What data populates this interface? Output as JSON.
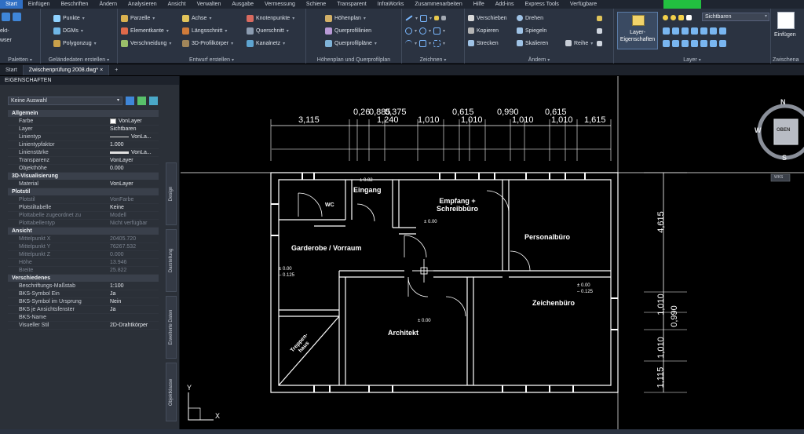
{
  "menu": {
    "tabs": [
      "Start",
      "Einfügen",
      "Beschriften",
      "Ändern",
      "Analysieren",
      "Ansicht",
      "Verwalten",
      "Ausgabe",
      "Vermessung",
      "Schiene",
      "Transparent",
      "InfraWorks",
      "Zusammenarbeiten",
      "Hilfe",
      "Add-ins",
      "Express Tools",
      "Verfügbare"
    ],
    "active": "Start"
  },
  "ribbon": {
    "left_stub": {
      "label_1": "ekt-",
      "label_2": "wser",
      "title": "Paletten"
    },
    "gelaende": {
      "title": "Geländedaten erstellen",
      "items": [
        "Punkte",
        "DGMs",
        "Polygonzug"
      ]
    },
    "entwurf": {
      "title": "Entwurf erstellen",
      "col1": [
        "Parzelle",
        "Elementkante",
        "Verschneidung"
      ],
      "col2": [
        "Achse",
        "Längsschnitt",
        "3D-Profilkörper"
      ],
      "col3": [
        "Knotenpunkte",
        "Querschnitt",
        "Kanalnetz"
      ]
    },
    "hoehenplan": {
      "title": "Höhenplan und Querprofilplan",
      "items": [
        "Höhenplan",
        "Querprofillinien",
        "Querprofilpläne"
      ]
    },
    "zeichnen": {
      "title": "Zeichnen"
    },
    "aendern": {
      "title": "Ändern",
      "col1": [
        "Verschieben",
        "Kopieren",
        "Strecken"
      ],
      "col2": [
        "Drehen",
        "Spiegeln",
        "Skalieren"
      ],
      "reihe": "Reihe"
    },
    "layer": {
      "button_line1": "Layer-",
      "button_line2": "Eigenschaften",
      "current": "Sichtbaren",
      "title": "Layer"
    },
    "einfuegen": {
      "label": "Einfügen",
      "title": "Zwischena"
    }
  },
  "document_tabs": [
    "Start",
    "Zwischenprüfung 2008.dwg*"
  ],
  "palette": {
    "title": "EIGENSCHAFTEN",
    "selection": "Keine Auswahl",
    "side_tabs": [
      "Design",
      "Darstellung",
      "Erweiterte Daten",
      "Objektklasse"
    ],
    "sections": [
      {
        "name": "Allgemein",
        "rows": [
          {
            "key": "Farbe",
            "value": "VonLayer"
          },
          {
            "key": "Layer",
            "value": "Sichtbaren"
          },
          {
            "key": "Linientyp",
            "value": "VonLa..."
          },
          {
            "key": "Linientypfaktor",
            "value": "1.000"
          },
          {
            "key": "Linienstärke",
            "value": "VonLa..."
          },
          {
            "key": "Transparenz",
            "value": "VonLayer"
          },
          {
            "key": "Objekthöhe",
            "value": "0.000"
          }
        ]
      },
      {
        "name": "3D-Visualisierung",
        "rows": [
          {
            "key": "Material",
            "value": "VonLayer"
          }
        ]
      },
      {
        "name": "Plotstil",
        "rows": [
          {
            "key": "Plotstil",
            "value": "VonFarbe"
          },
          {
            "key": "Plotstiltabelle",
            "value": "Keine"
          },
          {
            "key": "Plottabelle zugeordnet zu",
            "value": "Modell"
          },
          {
            "key": "Plottabellentyp",
            "value": "Nicht verfügbar"
          }
        ]
      },
      {
        "name": "Ansicht",
        "rows": [
          {
            "key": "Mittelpunkt X",
            "value": "20405.720"
          },
          {
            "key": "Mittelpunkt Y",
            "value": "76267.532"
          },
          {
            "key": "Mittelpunkt Z",
            "value": "0.000"
          },
          {
            "key": "Höhe",
            "value": "13.946"
          },
          {
            "key": "Breite",
            "value": "25.822"
          }
        ]
      },
      {
        "name": "Verschiedenes",
        "rows": [
          {
            "key": "Beschriftungs-Maßstab",
            "value": "1:100"
          },
          {
            "key": "BKS-Symbol Ein",
            "value": "Ja"
          },
          {
            "key": "BKS-Symbol im Ursprung",
            "value": "Nein"
          },
          {
            "key": "BKS je Ansichtsfenster",
            "value": "Ja"
          },
          {
            "key": "BKS-Name",
            "value": ""
          },
          {
            "key": "Visueller Stil",
            "value": "2D-Drahtkörper"
          }
        ]
      }
    ]
  },
  "drawing": {
    "dims_top": [
      "3,115",
      "0,26",
      "0,885",
      "0,375",
      "1,240",
      "1,010",
      "0,615",
      "1,010",
      "0,990",
      "1,010",
      "0,615",
      "1,010",
      "1,615"
    ],
    "dims_right": [
      "4,615",
      "1,010",
      "0,990",
      "1,010",
      "1,115"
    ],
    "rooms": {
      "eingang": "Eingang",
      "wc": "WC",
      "empfang_1": "Empfang +",
      "empfang_2": "Schreibbüro",
      "garderobe": "Garderobe / Vorraum",
      "personal": "Personalbüro",
      "zeichen": "Zeichenbüro",
      "architekt": "Architekt",
      "treppen_1": "Treppen-",
      "treppen_2": "haus"
    },
    "levels": {
      "eingang": "± 0.02",
      "empfang": "± 0.00",
      "garderobe_1": "± 0.00",
      "garderobe_2": "– 0.125",
      "zeichen_1": "± 0.00",
      "zeichen_2": "– 0.125",
      "architekt": "± 0.00"
    },
    "viewcube": {
      "n": "N",
      "w": "W",
      "s": "S",
      "face": "OBEN",
      "wks": "WKS"
    },
    "ucs": {
      "x": "X",
      "y": "Y"
    }
  },
  "colors": {
    "accent": "#2f6fc4",
    "ribbon": "#2b3341",
    "green": "#22c040"
  }
}
